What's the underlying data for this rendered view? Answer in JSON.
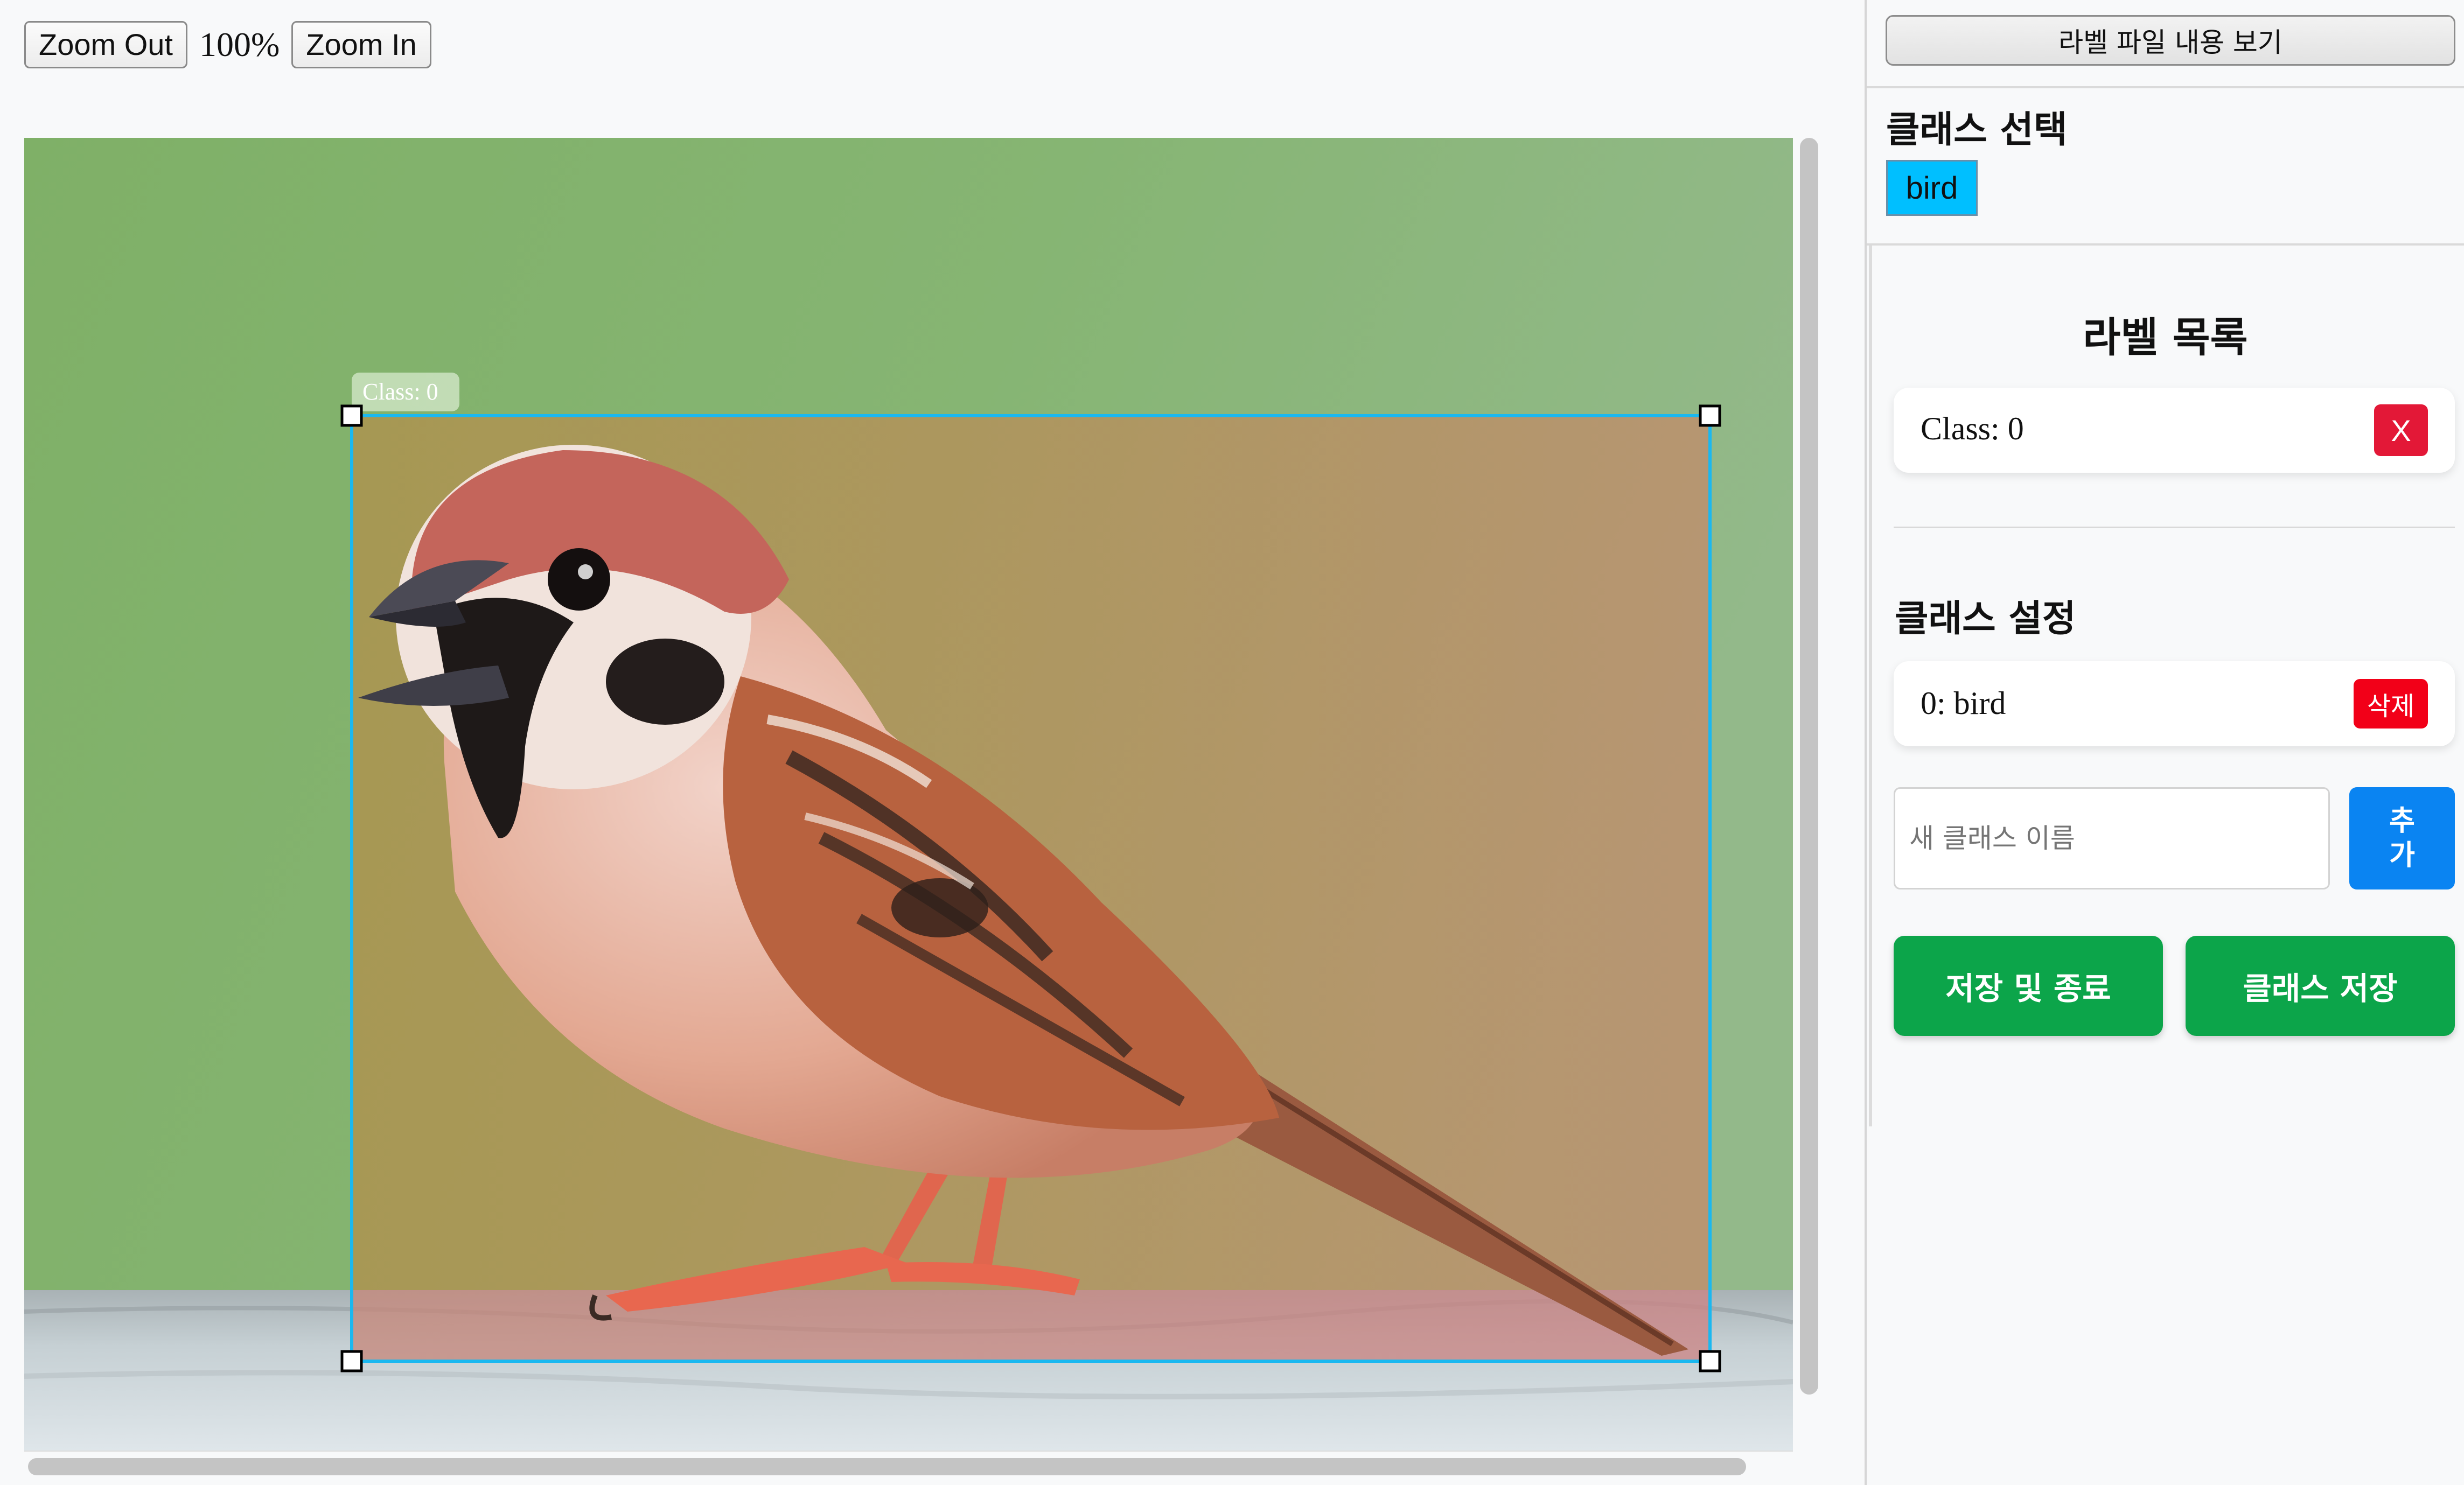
{
  "toolbar": {
    "zoom_out_label": "Zoom Out",
    "zoom_level": "100%",
    "zoom_in_label": "Zoom In"
  },
  "canvas": {
    "image_subject": "sparrow-photo",
    "annotation": {
      "label": "Class: 0",
      "color": "#1ab8f0"
    }
  },
  "sidebar": {
    "view_label_file_button": "라벨 파일 내용 보기",
    "class_select_title": "클래스 선택",
    "selected_class_chip": "bird",
    "chip_color": "#00bfff",
    "label_list_title": "라벨 목록",
    "labels": [
      {
        "text": "Class: 0",
        "remove_label": "X"
      }
    ],
    "class_settings_title": "클래스 설정",
    "classes": [
      {
        "text": "0: bird",
        "delete_label": "삭제"
      }
    ],
    "new_class_placeholder": "새 클래스 이름",
    "add_button": "추가",
    "save_exit_button": "저장 및 종료",
    "save_class_button": "클래스 저장"
  },
  "colors": {
    "danger": "#e31837",
    "primary": "#0a84f2",
    "success": "#0ca54a"
  }
}
